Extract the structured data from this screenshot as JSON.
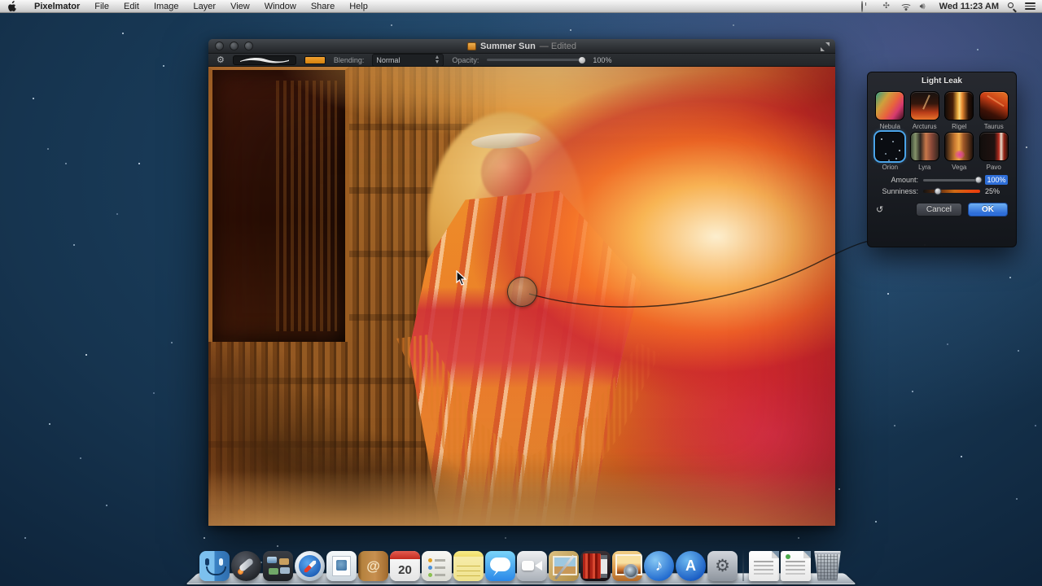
{
  "colors": {
    "accent_blue": "#2e6ed8",
    "selection_blue": "#4aa3e8",
    "brush_swatch_orange": "#e09020",
    "menubar_gray": "#d2d2d2",
    "desktop_blue": "#16344f"
  },
  "menu_bar": {
    "items": [
      "Pixelmator",
      "File",
      "Edit",
      "Image",
      "Layer",
      "View",
      "Window",
      "Share",
      "Help"
    ],
    "clock": "Wed 11:23 AM"
  },
  "window": {
    "title": "Summer Sun",
    "title_suffix": "— Edited",
    "toolbar": {
      "blending_label": "Blending:",
      "blending_value": "Normal",
      "opacity_label": "Opacity:",
      "opacity_value": "100%",
      "opacity_percent": 100
    }
  },
  "panel": {
    "title": "Light Leak",
    "effects": [
      {
        "name": "Nebula"
      },
      {
        "name": "Arcturus"
      },
      {
        "name": "Rigel"
      },
      {
        "name": "Taurus"
      },
      {
        "name": "Orion"
      },
      {
        "name": "Lyra"
      },
      {
        "name": "Vega"
      },
      {
        "name": "Pavo"
      }
    ],
    "selected_effect": "Orion",
    "amount_label": "Amount:",
    "amount_value": "100%",
    "amount_percent": 100,
    "sunniness_label": "Sunniness:",
    "sunniness_value": "25%",
    "sunniness_percent": 25,
    "cancel_label": "Cancel",
    "ok_label": "OK"
  },
  "dock": {
    "calendar_day": "20",
    "contacts_glyph": "@",
    "itunes_glyph": "♪",
    "appstore_glyph": "A",
    "prefs_glyph": "⚙",
    "items": [
      "finder",
      "launchpad",
      "mission-control",
      "safari",
      "mail",
      "contacts",
      "calendar",
      "reminders",
      "notes",
      "messages",
      "facetime",
      "preview",
      "photo-booth",
      "iphoto",
      "itunes",
      "app-store",
      "system-preferences",
      "documents-stack",
      "downloads-stack",
      "trash"
    ]
  },
  "icons": {
    "undo": "↺",
    "gear": "⚙",
    "volume": "◀))"
  }
}
